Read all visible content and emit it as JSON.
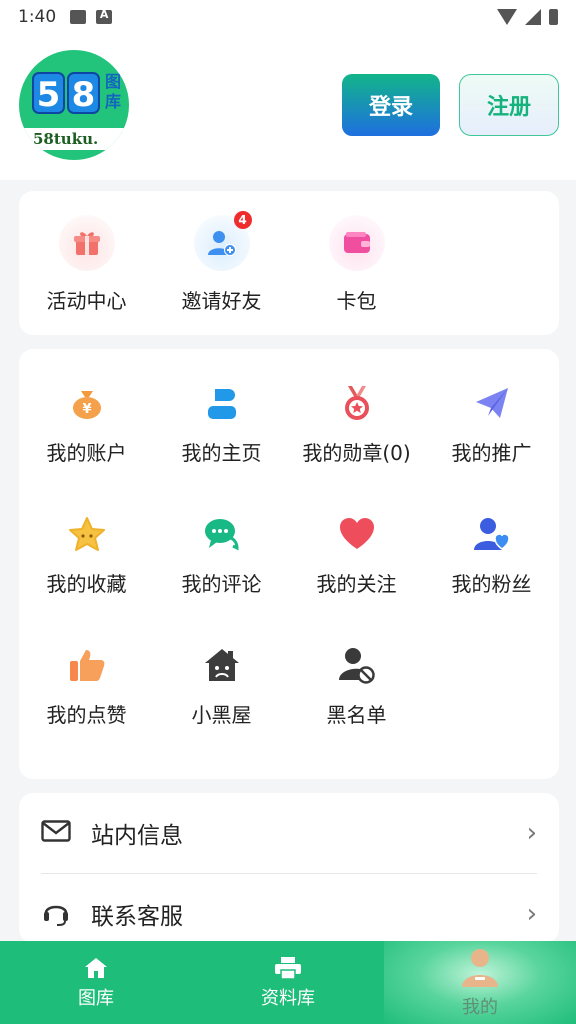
{
  "status_bar": {
    "time": "1:40"
  },
  "header": {
    "logo": {
      "digits": [
        "5",
        "8"
      ],
      "side_text": "图库",
      "footer_text": "58tuku."
    },
    "login_label": "登录",
    "register_label": "注册"
  },
  "quick_actions": [
    {
      "label": "活动中心",
      "icon": "gift-icon"
    },
    {
      "label": "邀请好友",
      "icon": "add-user-icon",
      "badge": "4"
    },
    {
      "label": "卡包",
      "icon": "wallet-icon"
    }
  ],
  "my_grid": [
    {
      "label": "我的账户",
      "icon": "money-bag-icon"
    },
    {
      "label": "我的主页",
      "icon": "person-icon"
    },
    {
      "label": "我的勋章(0)",
      "icon": "medal-icon"
    },
    {
      "label": "我的推广",
      "icon": "paper-plane-icon"
    },
    {
      "label": "我的收藏",
      "icon": "star-icon"
    },
    {
      "label": "我的评论",
      "icon": "chat-icon"
    },
    {
      "label": "我的关注",
      "icon": "heart-icon"
    },
    {
      "label": "我的粉丝",
      "icon": "fans-icon"
    },
    {
      "label": "我的点赞",
      "icon": "thumbs-up-icon"
    },
    {
      "label": "小黑屋",
      "icon": "sad-house-icon"
    },
    {
      "label": "黑名单",
      "icon": "blocked-user-icon"
    }
  ],
  "menu_list": [
    {
      "label": "站内信息",
      "icon": "mail-icon"
    },
    {
      "label": "联系客服",
      "icon": "headset-icon"
    }
  ],
  "tab_bar": [
    {
      "label": "图库",
      "icon": "home-icon"
    },
    {
      "label": "资料库",
      "icon": "printer-icon"
    },
    {
      "label": "我的",
      "icon": "profile-icon",
      "active": true
    }
  ],
  "colors": {
    "brand_green": "#1fbd7a",
    "login_gradient_end": "#1f6fe0",
    "badge_red": "#f02d2d"
  }
}
